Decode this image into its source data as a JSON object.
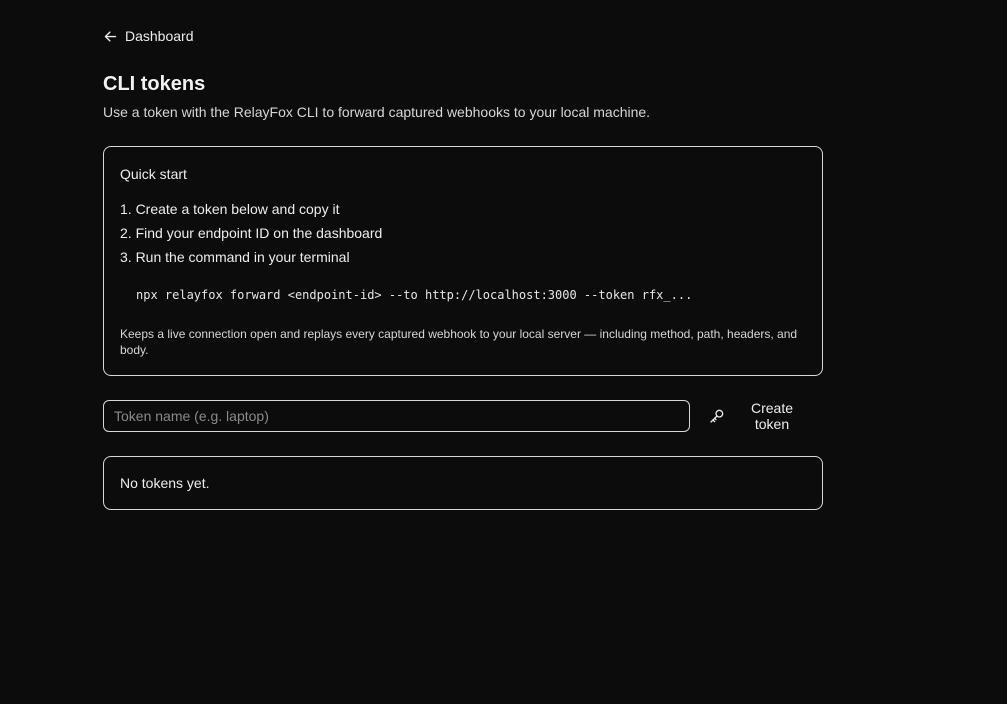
{
  "nav": {
    "back_label": "Dashboard",
    "back_icon": "arrow-left-icon"
  },
  "header": {
    "title": "CLI tokens",
    "subtitle": "Use a token with the RelayFox CLI to forward captured webhooks to your local machine."
  },
  "quickstart": {
    "title": "Quick start",
    "steps": [
      "1. Create a token below and copy it",
      "2. Find your endpoint ID on the dashboard",
      "3. Run the command in your terminal"
    ],
    "command": "npx relayfox forward <endpoint-id> --to http://localhost:3000 --token rfx_...",
    "note": "Keeps a live connection open and replays every captured webhook to your local server — including method, path, headers, and body."
  },
  "token_form": {
    "input_value": "",
    "input_placeholder": "Token name (e.g. laptop)",
    "create_label": "Create token",
    "create_icon": "key-icon"
  },
  "tokens": {
    "empty_message": "No tokens yet."
  },
  "colors": {
    "background": "#0c0c0c",
    "text": "#ededed",
    "border": "#d8d8d8",
    "placeholder": "#8a8a8a"
  }
}
